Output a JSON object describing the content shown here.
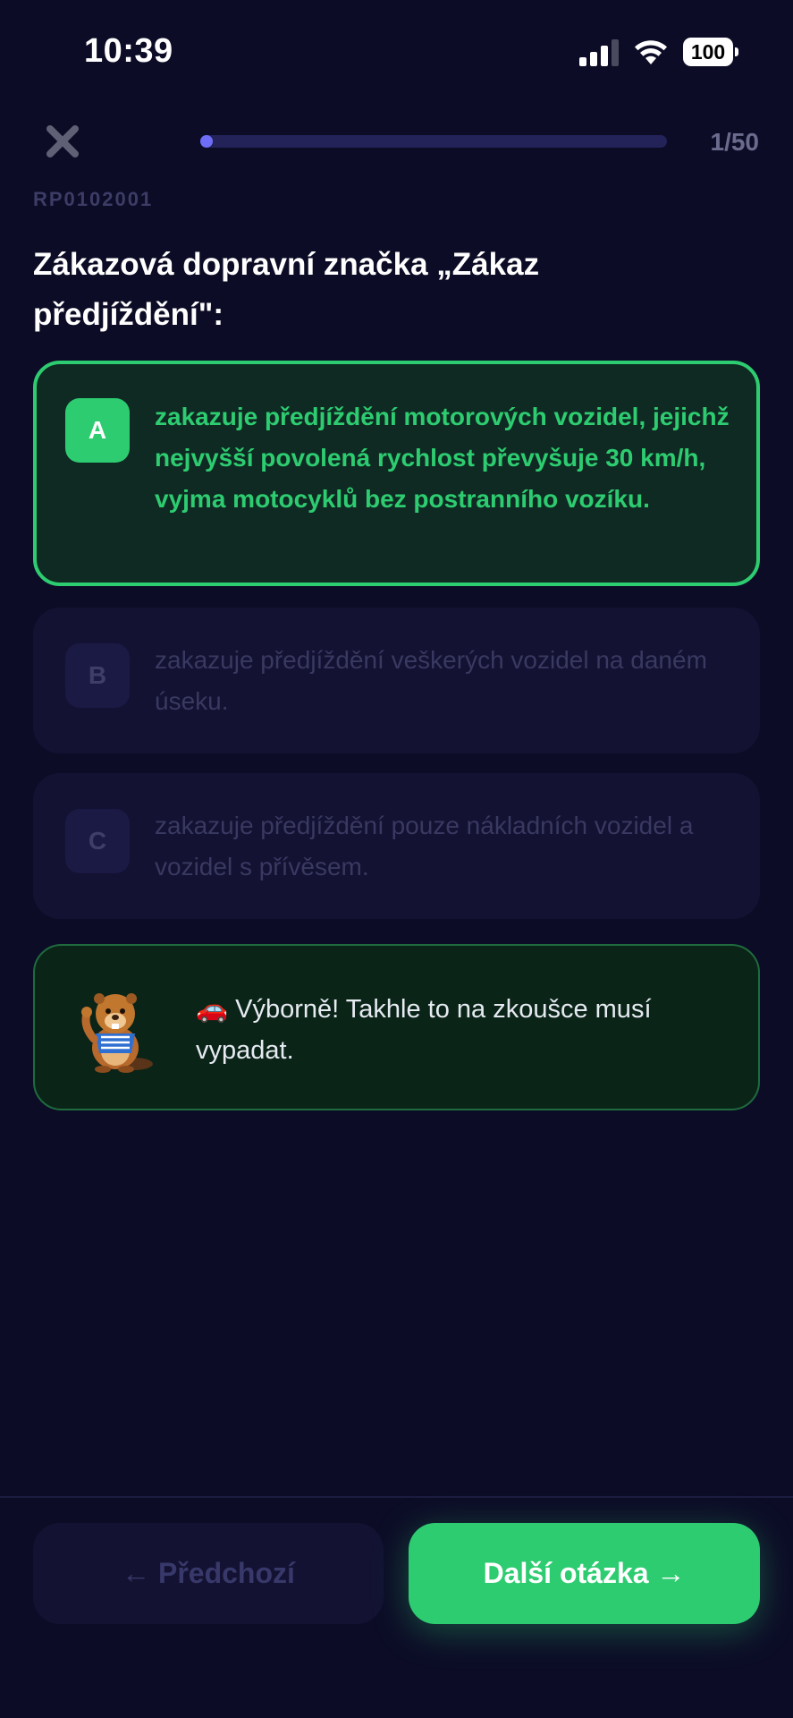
{
  "status_bar": {
    "time": "10:39",
    "battery": "100",
    "icons": [
      "cellular-signal-icon",
      "wifi-icon",
      "battery-icon"
    ]
  },
  "quiz": {
    "progress": {
      "current": 1,
      "total": 50,
      "label": "1/50",
      "fraction": 0.02,
      "fill_color": "#6d6df5"
    },
    "question_id": "RP0102001",
    "question": "Zákazová dopravní značka „Zákaz předjíždění\":",
    "answers": [
      {
        "letter": "A",
        "text": "zakazuje předjíždění motorových vozidel, jejichž nejvyšší povolená rychlost převyšuje 30 km/h, vyjma motocyklů bez postranního vozíku.",
        "state": "correct"
      },
      {
        "letter": "B",
        "text": "zakazuje předjíždění veškerých vozidel na daném úseku.",
        "state": "disabled"
      },
      {
        "letter": "C",
        "text": "zakazuje předjíždění pouze nákladních vozidel a vozidel s přívěsem.",
        "state": "disabled"
      }
    ],
    "feedback": {
      "mascot_icon": "beaver-mascot-icon",
      "text": "🚗 Výborně! Takhle to na zkoušce musí vypadat."
    }
  },
  "navigation": {
    "prev_label": "← Předchozí",
    "next_label": "Další otázka →"
  },
  "colors": {
    "background": "#0c0c26",
    "accent_green": "#2ecc71",
    "progress": "#6d6df5"
  }
}
